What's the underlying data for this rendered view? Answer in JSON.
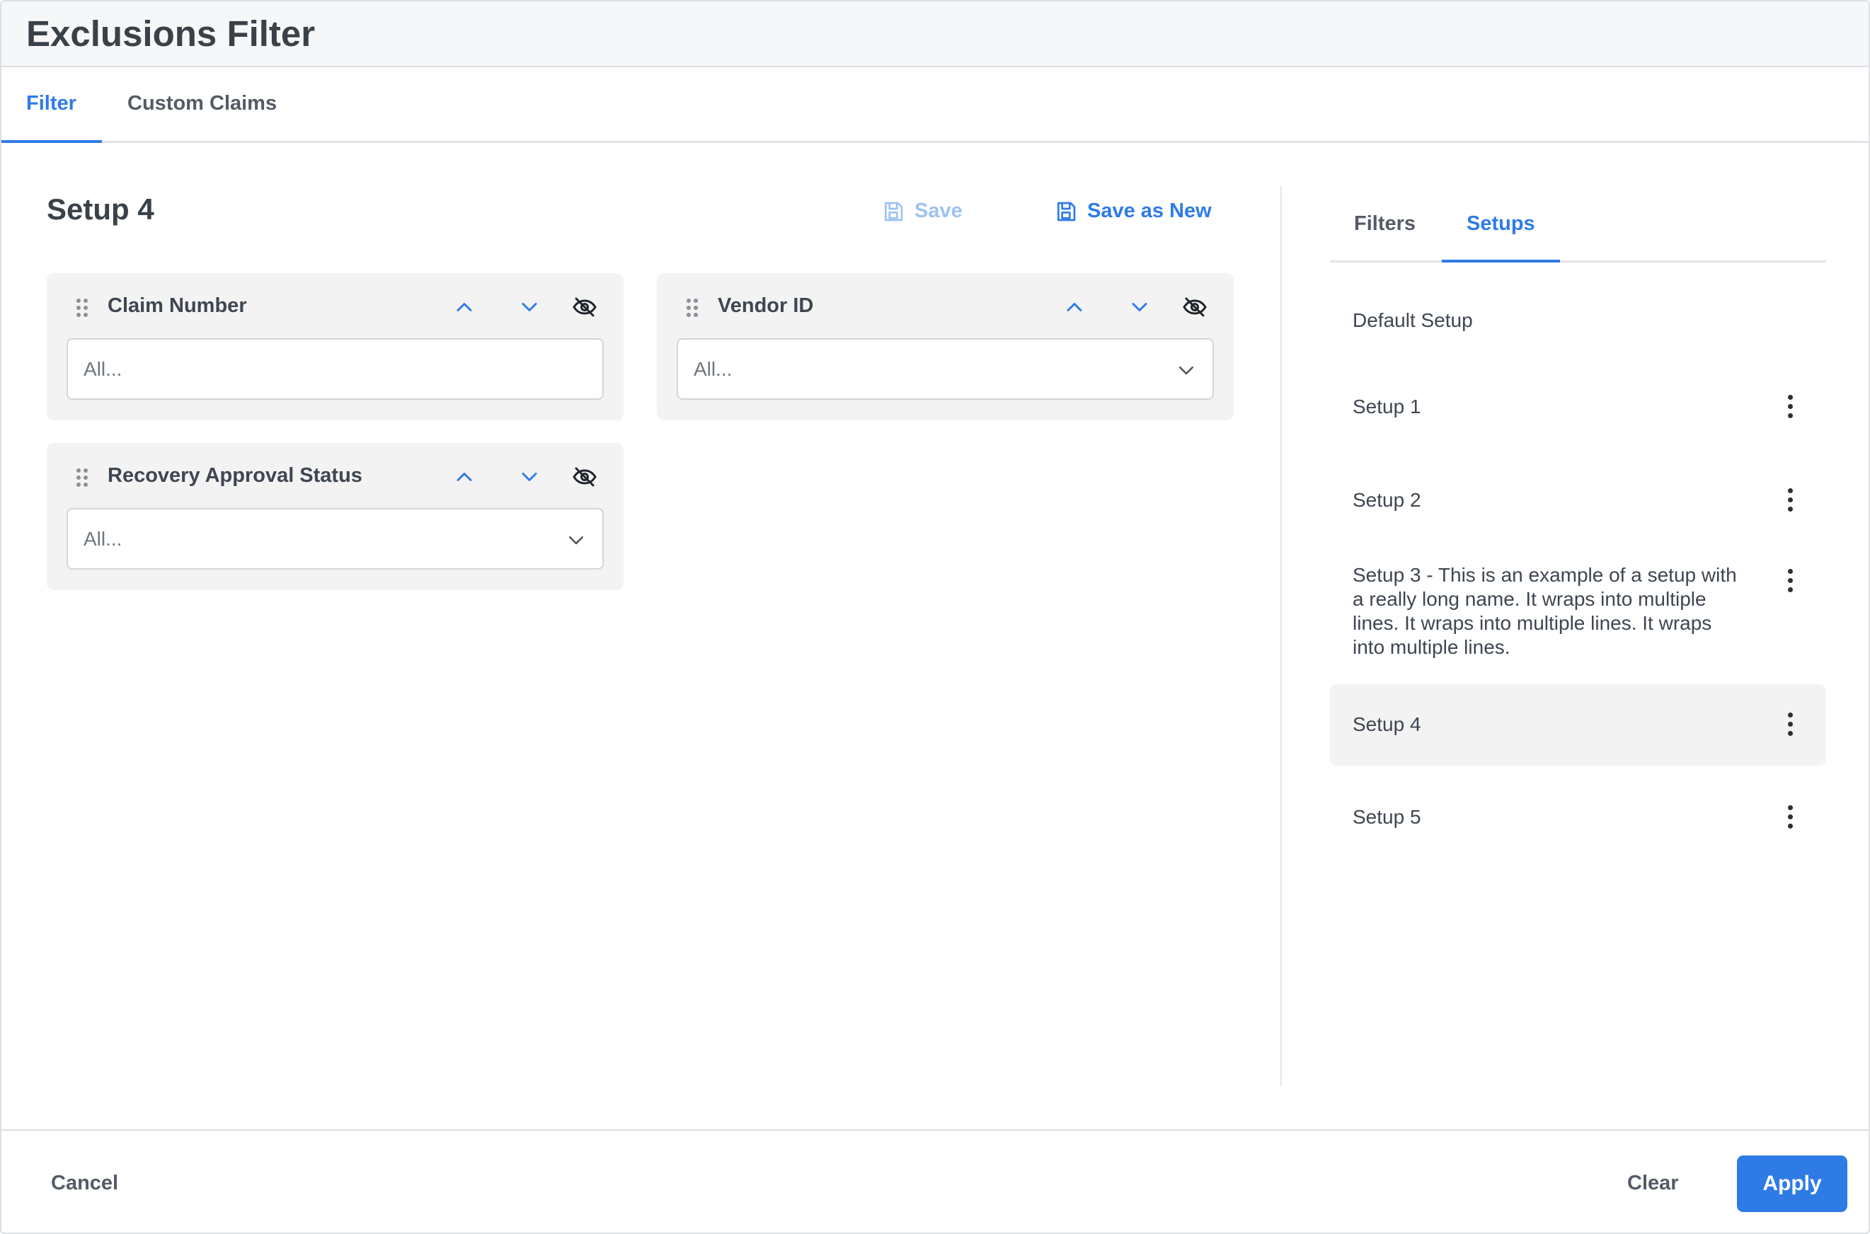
{
  "header": {
    "title": "Exclusions Filter"
  },
  "top_tabs": [
    {
      "label": "Filter",
      "active": true
    },
    {
      "label": "Custom Claims",
      "active": false
    }
  ],
  "main": {
    "setup_title": "Setup 4",
    "save_label": "Save",
    "save_as_new_label": "Save as New",
    "filters": [
      {
        "label": "Claim Number",
        "placeholder": "All...",
        "type": "text"
      },
      {
        "label": "Vendor ID",
        "placeholder": "All...",
        "type": "select"
      },
      {
        "label": "Recovery Approval Status",
        "placeholder": "All...",
        "type": "select"
      }
    ]
  },
  "side_panel": {
    "tabs": [
      {
        "label": "Filters",
        "active": false
      },
      {
        "label": "Setups",
        "active": true
      }
    ],
    "setups": [
      {
        "name": "Default Setup",
        "has_menu": false,
        "selected": false
      },
      {
        "name": "Setup 1",
        "has_menu": true,
        "selected": false
      },
      {
        "name": "Setup 2",
        "has_menu": true,
        "selected": false
      },
      {
        "name": "Setup 3 - This is an example of a setup with a really long name. It wraps into multiple lines. It wraps into multiple lines. It wraps into multiple lines.",
        "has_menu": true,
        "selected": false
      },
      {
        "name": "Setup 4",
        "has_menu": true,
        "selected": true
      },
      {
        "name": "Setup 5",
        "has_menu": true,
        "selected": false
      }
    ]
  },
  "footer": {
    "cancel_label": "Cancel",
    "clear_label": "Clear",
    "apply_label": "Apply"
  },
  "colors": {
    "accent": "#2f7be6",
    "accent_disabled": "#9ec2f2",
    "card_bg": "#f3f3f3",
    "header_bg": "#f6f7f8"
  },
  "icons": {
    "save": "floppy-disk-icon",
    "drag": "drag-handle-icon",
    "up": "chevron-up-icon",
    "down": "chevron-down-icon",
    "visibility": "eye-off-icon",
    "menu": "kebab-menu-icon"
  }
}
